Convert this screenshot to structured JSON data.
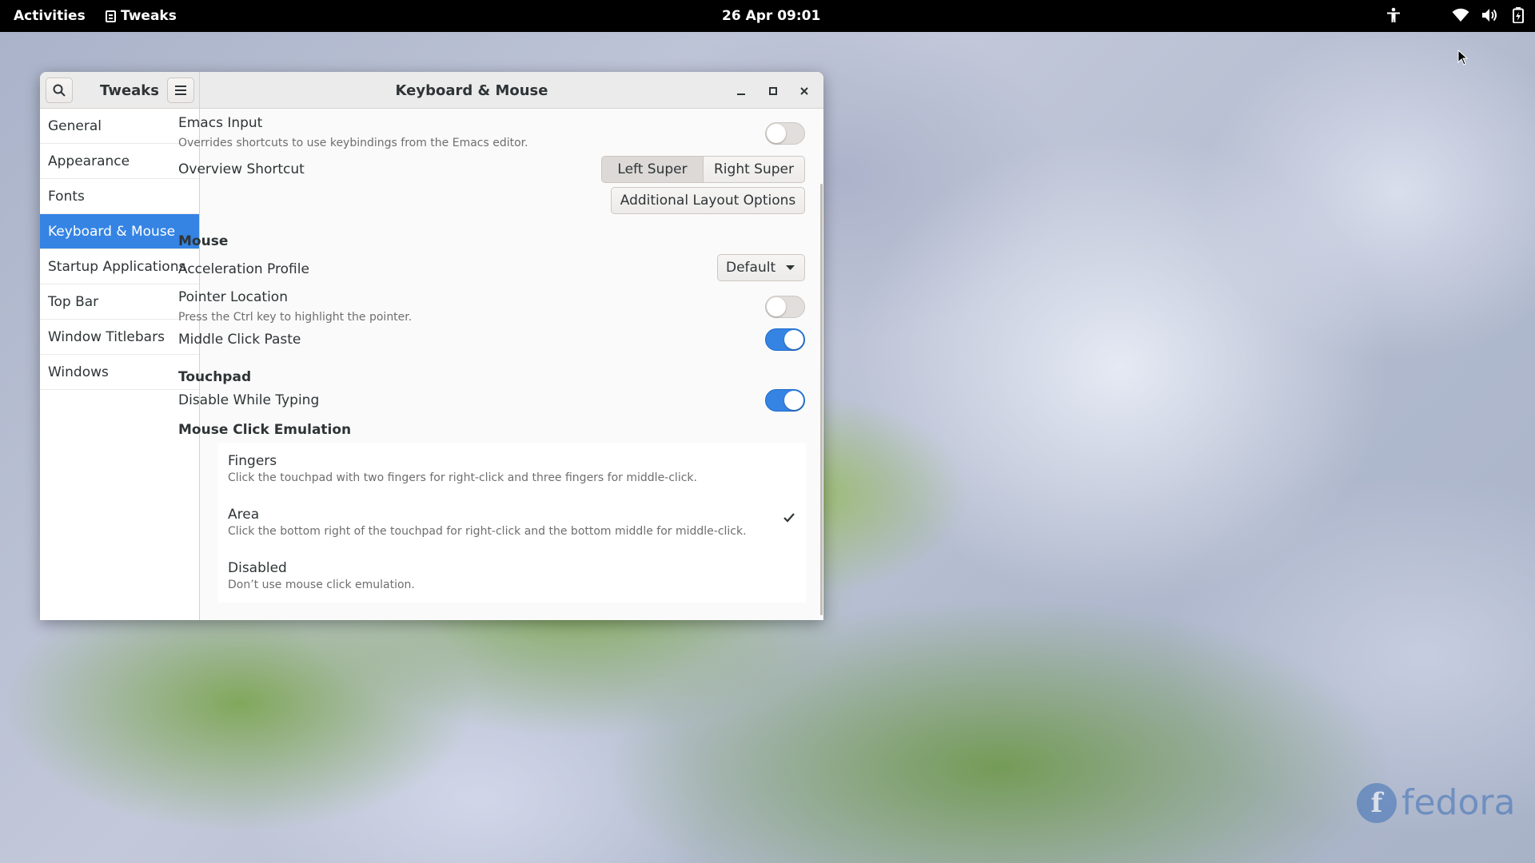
{
  "topbar": {
    "activities": "Activities",
    "app_name": "Tweaks",
    "clock": "26 Apr  09:01",
    "status_icons": [
      "accessibility-icon",
      "wifi-icon",
      "volume-icon",
      "battery-icon"
    ]
  },
  "window": {
    "sidebar_title": "Tweaks",
    "title": "Keyboard & Mouse"
  },
  "sidebar": {
    "items": [
      {
        "label": "General"
      },
      {
        "label": "Appearance"
      },
      {
        "label": "Fonts"
      },
      {
        "label": "Keyboard & Mouse",
        "selected": true
      },
      {
        "label": "Startup Applications"
      },
      {
        "label": "Top Bar"
      },
      {
        "label": "Window Titlebars"
      },
      {
        "label": "Windows"
      }
    ]
  },
  "keyboard": {
    "emacs_title": "Emacs Input",
    "emacs_sub": "Overrides shortcuts to use keybindings from the Emacs editor.",
    "emacs_on": false,
    "overview_title": "Overview Shortcut",
    "overview_left": "Left Super",
    "overview_right": "Right Super",
    "overview_selected": "Left Super",
    "layout_options": "Additional Layout Options"
  },
  "mouse": {
    "section": "Mouse",
    "accel_title": "Acceleration Profile",
    "accel_value": "Default",
    "pointer_title": "Pointer Location",
    "pointer_sub": "Press the Ctrl key to highlight the pointer.",
    "pointer_on": false,
    "middle_title": "Middle Click Paste",
    "middle_on": true
  },
  "touchpad": {
    "section": "Touchpad",
    "dwt_title": "Disable While Typing",
    "dwt_on": true,
    "emulation_section": "Mouse Click Emulation",
    "options": [
      {
        "title": "Fingers",
        "sub": "Click the touchpad with two fingers for right-click and three fingers for middle-click."
      },
      {
        "title": "Area",
        "sub": "Click the bottom right of the touchpad for right-click and the bottom middle for middle-click.",
        "checked": true
      },
      {
        "title": "Disabled",
        "sub": "Don’t use mouse click emulation."
      }
    ]
  },
  "branding": {
    "fedora_text": "fedora"
  },
  "colors": {
    "accent": "#3584e4",
    "topbar": "#000000"
  }
}
